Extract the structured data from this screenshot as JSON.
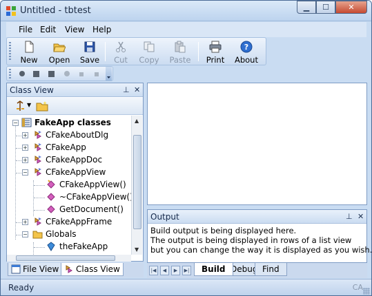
{
  "window": {
    "title": "Untitled - tbtest"
  },
  "menu": [
    "File",
    "Edit",
    "View",
    "Help"
  ],
  "toolbar": {
    "buttons": [
      {
        "label": "New",
        "icon": "new-document-icon",
        "enabled": true
      },
      {
        "label": "Open",
        "icon": "open-folder-icon",
        "enabled": true
      },
      {
        "label": "Save",
        "icon": "save-disk-icon",
        "enabled": true
      },
      {
        "label": "Cut",
        "icon": "scissors-icon",
        "enabled": false
      },
      {
        "label": "Copy",
        "icon": "copy-icon",
        "enabled": false
      },
      {
        "label": "Paste",
        "icon": "paste-icon",
        "enabled": false
      },
      {
        "label": "Print",
        "icon": "printer-icon",
        "enabled": true
      },
      {
        "label": "About",
        "icon": "help-icon",
        "enabled": true
      }
    ]
  },
  "class_view": {
    "title": "Class View",
    "tree": [
      {
        "label": "FakeApp classes",
        "icon": "project-icon",
        "bold": true,
        "expander": "-"
      },
      {
        "label": "CFakeAboutDlg",
        "icon": "class-icon",
        "expander": "+"
      },
      {
        "label": "CFakeApp",
        "icon": "class-icon",
        "expander": "+"
      },
      {
        "label": "CFakeAppDoc",
        "icon": "class-icon",
        "expander": "+"
      },
      {
        "label": "CFakeAppView",
        "icon": "class-icon",
        "expander": "-"
      },
      {
        "label": "CFakeAppView()",
        "icon": "method-icon",
        "expander": ""
      },
      {
        "label": "~CFakeAppView()",
        "icon": "method-icon",
        "expander": ""
      },
      {
        "label": "GetDocument()",
        "icon": "method-icon",
        "expander": ""
      },
      {
        "label": "CFakeAppFrame",
        "icon": "class-icon",
        "expander": "+"
      },
      {
        "label": "Globals",
        "icon": "folder-icon",
        "expander": "-"
      },
      {
        "label": "theFakeApp",
        "icon": "variable-icon",
        "expander": ""
      }
    ]
  },
  "left_tabs": [
    {
      "label": "File View",
      "active": false
    },
    {
      "label": "Class View",
      "active": true
    }
  ],
  "output": {
    "title": "Output",
    "lines": [
      "Build output is being displayed here.",
      "The output is being displayed in rows of a list view",
      "but you can change the way it is displayed as you wish..."
    ],
    "tabs": [
      {
        "label": "Build",
        "active": true
      },
      {
        "label": "Debug",
        "active": false
      },
      {
        "label": "Find",
        "active": false
      }
    ]
  },
  "status": {
    "text": "Ready",
    "indicator": "CA"
  }
}
